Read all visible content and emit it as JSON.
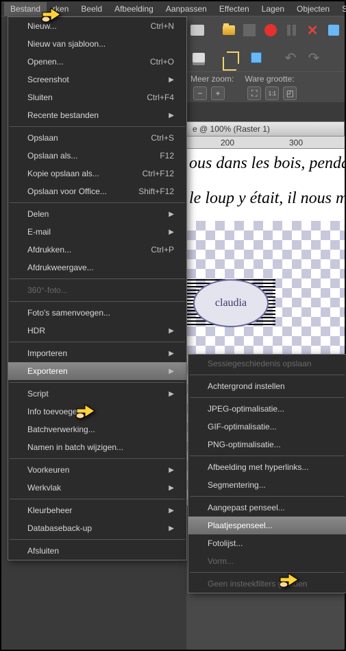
{
  "menubar": [
    "Bestand",
    "rken",
    "Beeld",
    "Afbeelding",
    "Aanpassen",
    "Effecten",
    "Lagen",
    "Objecten",
    "Sele"
  ],
  "zoom": {
    "label1": "Meer zoom:",
    "label2": "Ware grootte:"
  },
  "doc": {
    "title": "e @ 100% (Raster 1)"
  },
  "ruler": {
    "t1": "200",
    "t2": "300"
  },
  "script_line1": "ous dans les bois, pendant",
  "script_line2": "le loup y était, il nous ma",
  "claudia": "claudia",
  "file_menu": [
    {
      "t": "item",
      "label": "Nieuw...",
      "sc": "Ctrl+N"
    },
    {
      "t": "item",
      "label": "Nieuw van sjabloon..."
    },
    {
      "t": "item",
      "label": "Openen...",
      "sc": "Ctrl+O"
    },
    {
      "t": "sub",
      "label": "Screenshot"
    },
    {
      "t": "item",
      "label": "Sluiten",
      "sc": "Ctrl+F4"
    },
    {
      "t": "sub",
      "label": "Recente bestanden"
    },
    {
      "t": "sep"
    },
    {
      "t": "item",
      "label": "Opslaan",
      "sc": "Ctrl+S"
    },
    {
      "t": "item",
      "label": "Opslaan als...",
      "sc": "F12"
    },
    {
      "t": "item",
      "label": "Kopie opslaan als...",
      "sc": "Ctrl+F12"
    },
    {
      "t": "item",
      "label": "Opslaan voor Office...",
      "sc": "Shift+F12"
    },
    {
      "t": "sep"
    },
    {
      "t": "sub",
      "label": "Delen"
    },
    {
      "t": "sub",
      "label": "E-mail"
    },
    {
      "t": "item",
      "label": "Afdrukken...",
      "sc": "Ctrl+P"
    },
    {
      "t": "item",
      "label": "Afdrukweergave..."
    },
    {
      "t": "sep"
    },
    {
      "t": "item",
      "label": "360°-foto...",
      "disabled": true
    },
    {
      "t": "sep"
    },
    {
      "t": "item",
      "label": "Foto's samenvoegen..."
    },
    {
      "t": "sub",
      "label": "HDR"
    },
    {
      "t": "sep"
    },
    {
      "t": "sub",
      "label": "Importeren"
    },
    {
      "t": "sub",
      "label": "Exporteren",
      "hl": true
    },
    {
      "t": "sep"
    },
    {
      "t": "sub",
      "label": "Script"
    },
    {
      "t": "item",
      "label": "Info toevoegen..."
    },
    {
      "t": "item",
      "label": "Batchverwerking..."
    },
    {
      "t": "item",
      "label": "Namen in batch wijzigen..."
    },
    {
      "t": "sep"
    },
    {
      "t": "sub",
      "label": "Voorkeuren"
    },
    {
      "t": "sub",
      "label": "Werkvlak"
    },
    {
      "t": "sep"
    },
    {
      "t": "sub",
      "label": "Kleurbeheer"
    },
    {
      "t": "sub",
      "label": "Databaseback-up"
    },
    {
      "t": "sep"
    },
    {
      "t": "item",
      "label": "Afsluiten"
    }
  ],
  "export_menu": [
    {
      "t": "item",
      "label": "Sessiegeschiedenis opslaan",
      "disabled": true
    },
    {
      "t": "sep"
    },
    {
      "t": "item",
      "label": "Achtergrond instellen"
    },
    {
      "t": "sep"
    },
    {
      "t": "item",
      "label": "JPEG-optimalisatie..."
    },
    {
      "t": "item",
      "label": "GIF-optimalisatie..."
    },
    {
      "t": "item",
      "label": "PNG-optimalisatie..."
    },
    {
      "t": "sep"
    },
    {
      "t": "item",
      "label": "Afbeelding met hyperlinks..."
    },
    {
      "t": "item",
      "label": "Segmentering..."
    },
    {
      "t": "sep"
    },
    {
      "t": "item",
      "label": "Aangepast penseel..."
    },
    {
      "t": "item",
      "label": "Plaatjespenseel...",
      "hl": true
    },
    {
      "t": "item",
      "label": "Fotolijst..."
    },
    {
      "t": "item",
      "label": "Vorm...",
      "disabled": true
    },
    {
      "t": "sep"
    },
    {
      "t": "item",
      "label": "Geen insteekfilters geladen",
      "disabled": true
    }
  ]
}
